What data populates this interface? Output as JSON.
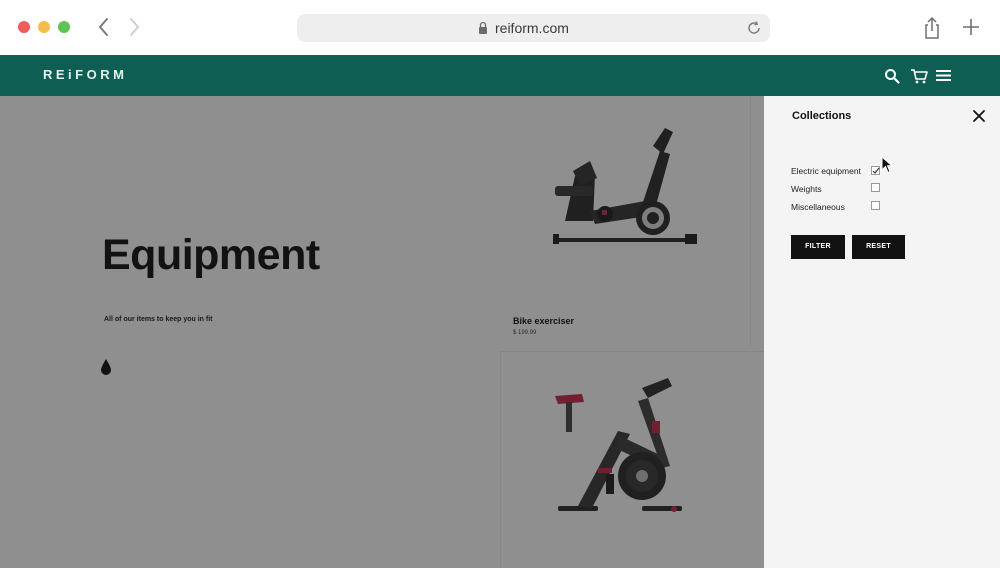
{
  "browser": {
    "url": "reiform.com"
  },
  "site": {
    "logo": "REiFORM"
  },
  "hero": {
    "title": "Equipment",
    "subtitle": "All of our items to keep you in fit"
  },
  "products": [
    {
      "name": "Bike exerciser",
      "price": "$ 199.99"
    }
  ],
  "filter_panel": {
    "title": "Collections",
    "options": [
      {
        "label": "Electric equipment",
        "checked": true
      },
      {
        "label": "Weights",
        "checked": false
      },
      {
        "label": "Miscellaneous",
        "checked": false
      }
    ],
    "filter_label": "FILTER",
    "reset_label": "RESET"
  },
  "colors": {
    "header_bg": "#0f5e53",
    "button_bg": "#121212"
  }
}
